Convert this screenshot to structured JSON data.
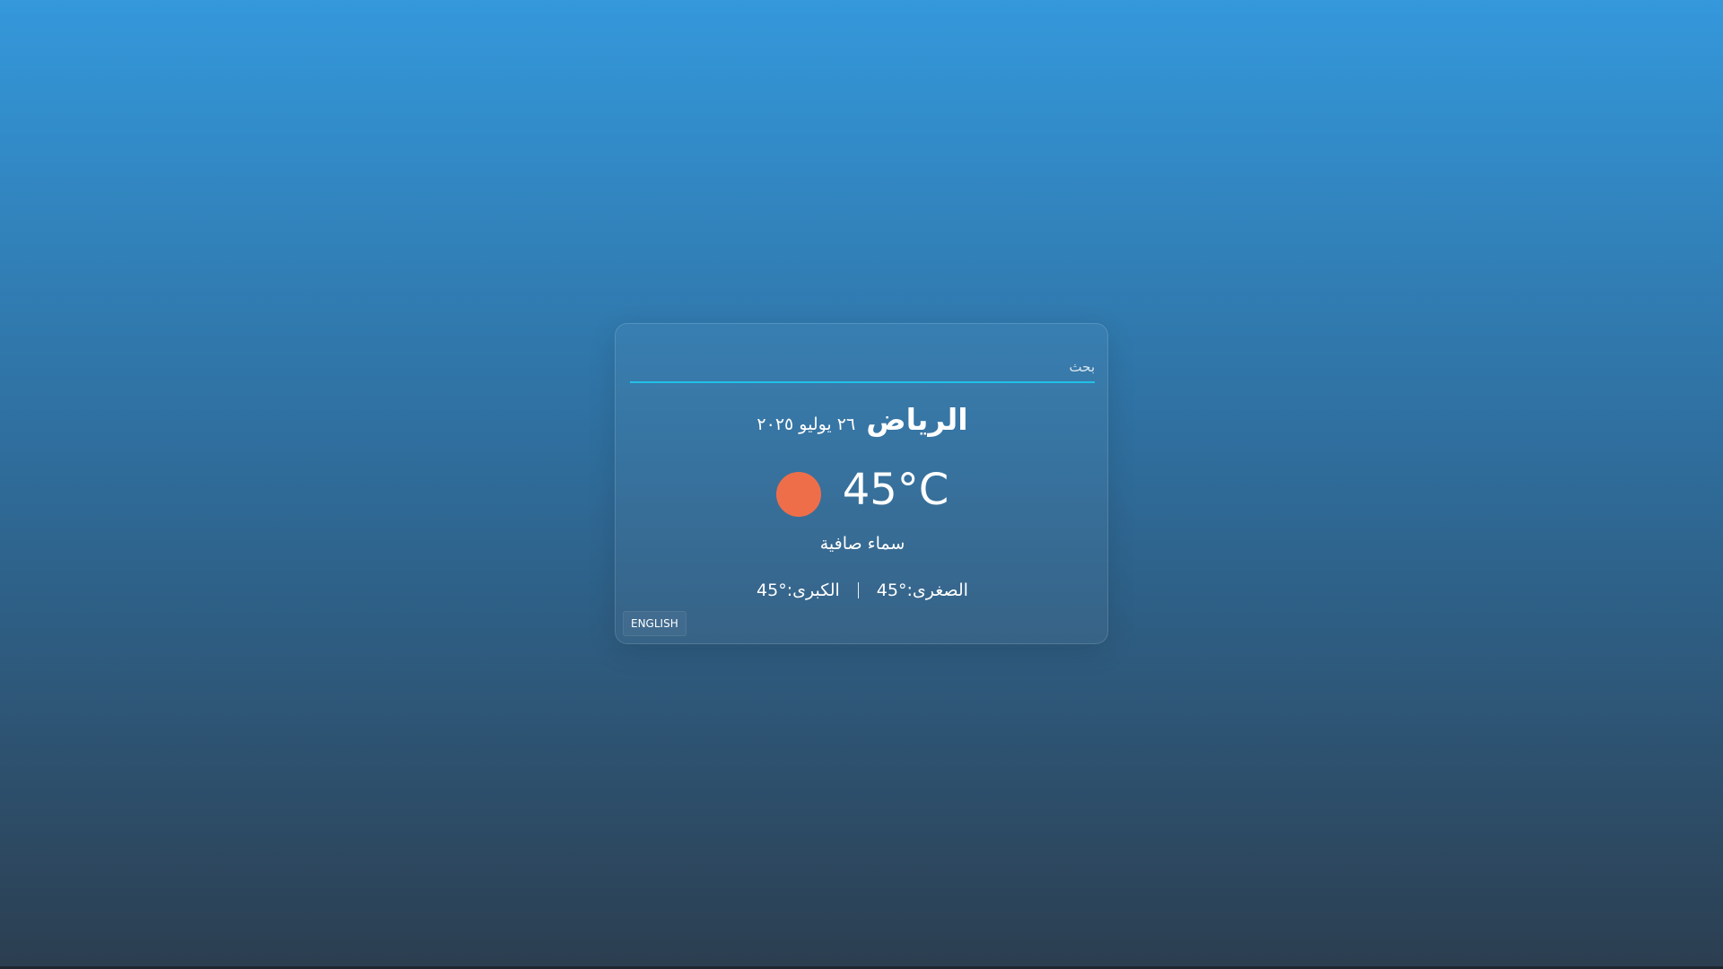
{
  "search": {
    "placeholder": "بحث",
    "value": ""
  },
  "weather": {
    "city": "الرياض",
    "date": "٢٦ يوليو ٢٠٢٥",
    "temperature": "45°C",
    "icon": "sun-icon",
    "icon_color": "#ee6e4a",
    "description": "سماء صافية",
    "min_label": "الصغرى:",
    "min_value": "45°",
    "max_label": "الكبرى:",
    "max_value": "45°"
  },
  "language_button": {
    "label": "ENGLISH"
  },
  "colors": {
    "background_top": "#3498db",
    "background_bottom": "#2c3e50",
    "search_underline": "#22c0e6"
  }
}
